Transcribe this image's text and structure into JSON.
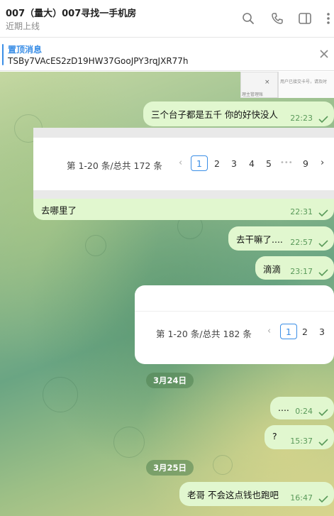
{
  "header": {
    "title": "007（量大）007寻找一手机房",
    "subtitle": "近期上线",
    "icons": [
      "search-icon",
      "phone-icon",
      "sidebar-toggle-icon",
      "more-icon"
    ]
  },
  "pinned": {
    "title": "置顶消息",
    "text": "TSBy7VAcES2zD19HW37GooJPY3rqJXR77h"
  },
  "thumbnail": {
    "close": "×",
    "text_a": "用户已接交卡号，请及时",
    "text_b": "理主管理账"
  },
  "messages": [
    {
      "text": "三个台子都是五千 你的好快没人",
      "time": "22:23"
    },
    {
      "text": "去哪里了",
      "time": "22:31"
    },
    {
      "text": "去干嘛了....",
      "time": "22:57"
    },
    {
      "text": "滴滴",
      "time": "23:17"
    },
    {
      "text": "....",
      "time": "0:24"
    },
    {
      "text": "?",
      "time": "15:37"
    },
    {
      "text": "老哥 不会这点钱也跑吧",
      "time": "16:47"
    }
  ],
  "pagination_1": {
    "summary": "第 1-20 条/总共 172 条",
    "prev": "‹",
    "current": "1",
    "pages": [
      "2",
      "3",
      "4",
      "5"
    ],
    "ellipsis": "•••",
    "last": "9",
    "next": "›"
  },
  "pagination_2": {
    "summary": "第 1-20 条/总共 182 条",
    "prev": "‹",
    "current": "1",
    "pages": [
      "2",
      "3"
    ]
  },
  "dates": [
    "3月24日",
    "3月25日"
  ],
  "colors": {
    "accent": "#3a8ee6",
    "bubble": "#e1f7cf",
    "time": "#5a9a5a"
  }
}
